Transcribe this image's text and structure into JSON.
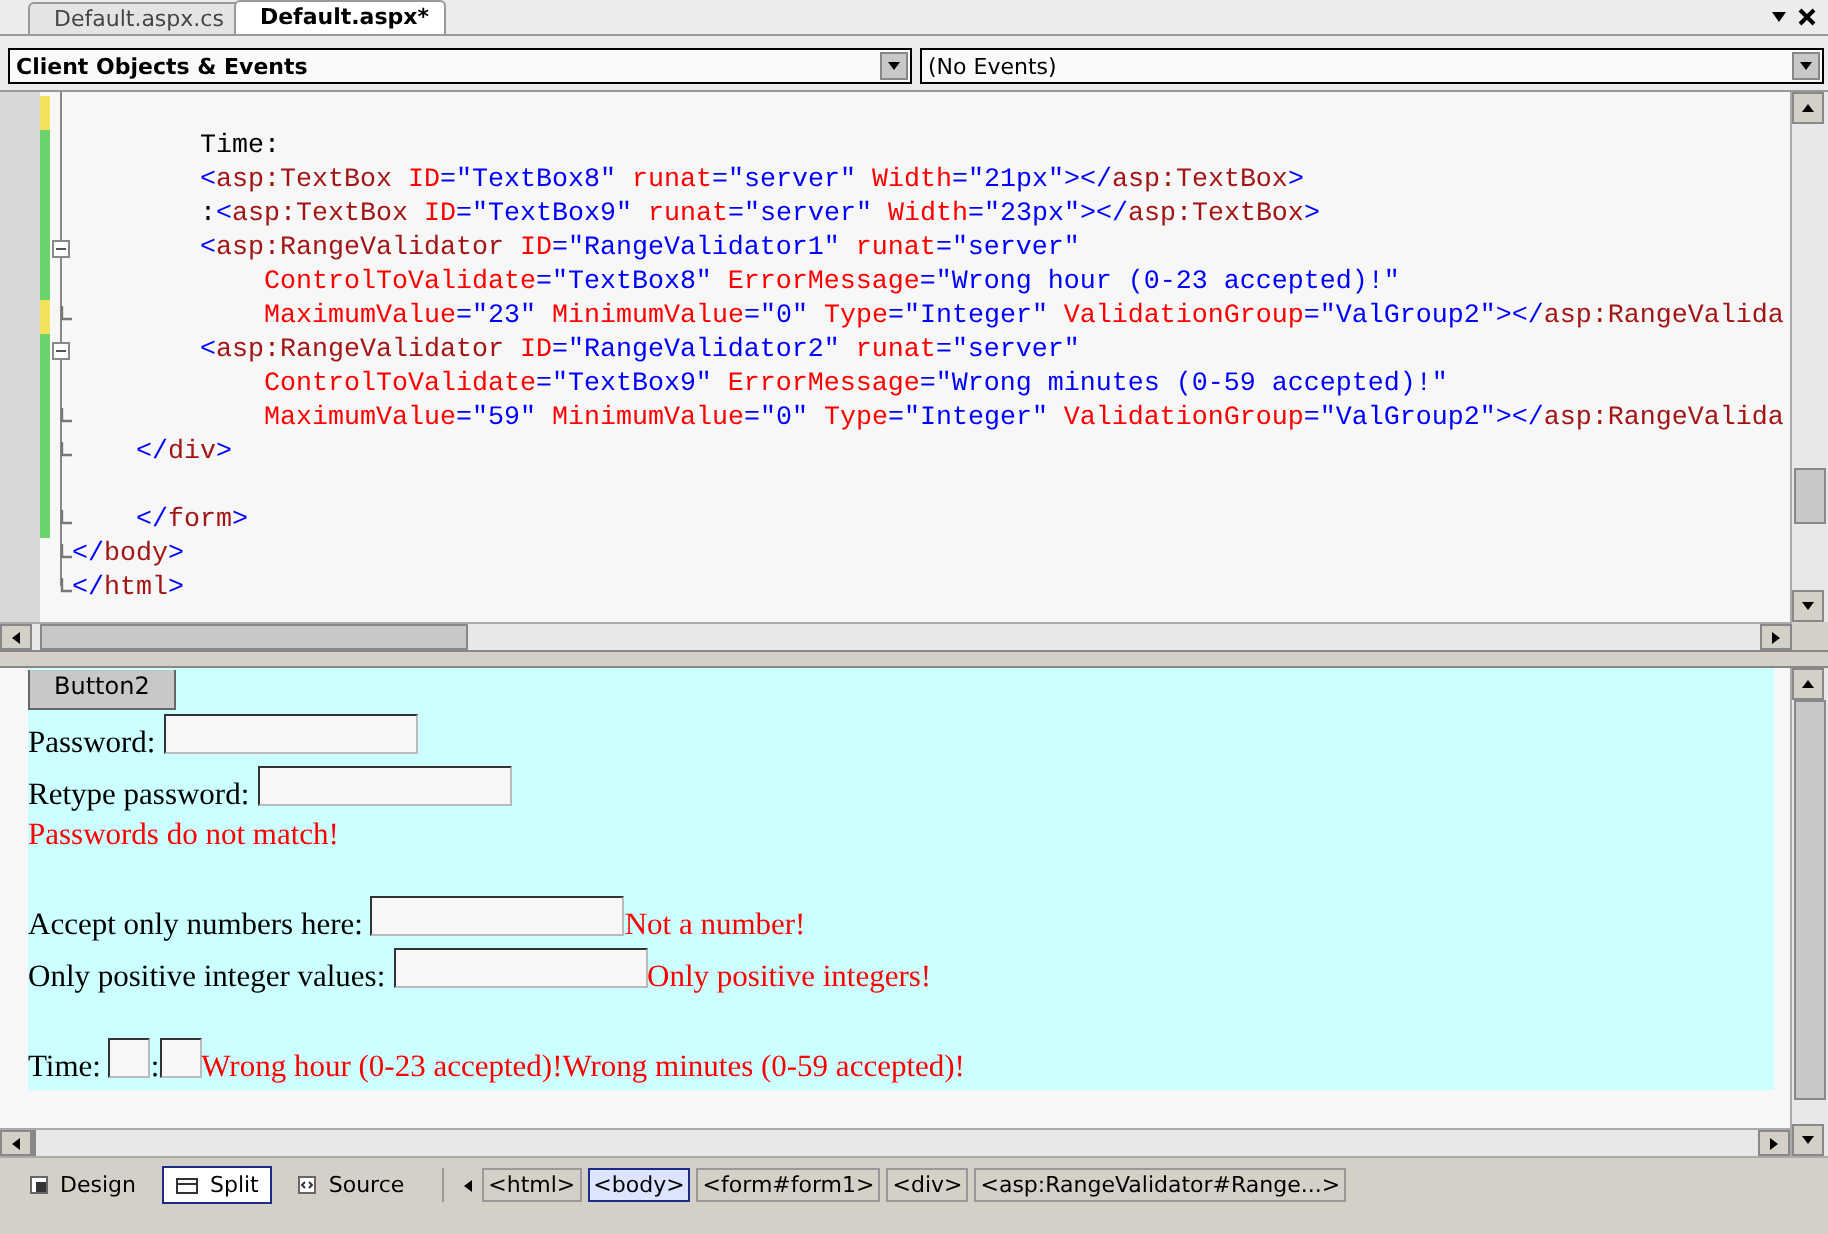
{
  "tabs": [
    {
      "label": "Default.aspx.cs",
      "selected": false
    },
    {
      "label": "Default.aspx*",
      "selected": true
    }
  ],
  "dropdowns": [
    {
      "value": "Client Objects & Events"
    },
    {
      "value": "(No Events)"
    }
  ],
  "code_lines": [
    {
      "modified": true,
      "saved": false,
      "foldable": false,
      "block_end": false
    },
    {
      "modified": true,
      "saved": true,
      "foldable": false,
      "block_end": false,
      "tokens": [
        {
          "kind": "text",
          "text": "        Time:"
        }
      ]
    },
    {
      "modified": true,
      "saved": true,
      "foldable": false,
      "block_end": false,
      "tokens": [
        {
          "kind": "punct",
          "text": "        <"
        },
        {
          "kind": "tag",
          "text": "asp:TextBox"
        },
        {
          "kind": "attr",
          "text": " ID"
        },
        {
          "kind": "punct",
          "text": "="
        },
        {
          "kind": "value",
          "text": "\"TextBox8\""
        },
        {
          "kind": "attr",
          "text": " runat"
        },
        {
          "kind": "punct",
          "text": "="
        },
        {
          "kind": "value",
          "text": "\"server\""
        },
        {
          "kind": "attr",
          "text": " Width"
        },
        {
          "kind": "punct",
          "text": "="
        },
        {
          "kind": "value",
          "text": "\"21px\""
        },
        {
          "kind": "punct",
          "text": "></"
        },
        {
          "kind": "tag",
          "text": "asp:TextBox"
        },
        {
          "kind": "punct",
          "text": ">"
        }
      ]
    },
    {
      "modified": true,
      "saved": true,
      "foldable": false,
      "block_end": false,
      "tokens": [
        {
          "kind": "text",
          "text": "        :"
        },
        {
          "kind": "punct",
          "text": "<"
        },
        {
          "kind": "tag",
          "text": "asp:TextBox"
        },
        {
          "kind": "attr",
          "text": " ID"
        },
        {
          "kind": "punct",
          "text": "="
        },
        {
          "kind": "value",
          "text": "\"TextBox9\""
        },
        {
          "kind": "attr",
          "text": " runat"
        },
        {
          "kind": "punct",
          "text": "="
        },
        {
          "kind": "value",
          "text": "\"server\""
        },
        {
          "kind": "attr",
          "text": " Width"
        },
        {
          "kind": "punct",
          "text": "="
        },
        {
          "kind": "value",
          "text": "\"23px\""
        },
        {
          "kind": "punct",
          "text": "></"
        },
        {
          "kind": "tag",
          "text": "asp:TextBox"
        },
        {
          "kind": "punct",
          "text": ">"
        }
      ]
    },
    {
      "modified": true,
      "saved": true,
      "foldable": true,
      "block_end": false,
      "tokens": [
        {
          "kind": "punct",
          "text": "        <"
        },
        {
          "kind": "tag",
          "text": "asp:RangeValidator"
        },
        {
          "kind": "attr",
          "text": " ID"
        },
        {
          "kind": "punct",
          "text": "="
        },
        {
          "kind": "value",
          "text": "\"RangeValidator1\""
        },
        {
          "kind": "attr",
          "text": " runat"
        },
        {
          "kind": "punct",
          "text": "="
        },
        {
          "kind": "value",
          "text": "\"server\""
        }
      ]
    },
    {
      "modified": true,
      "saved": true,
      "foldable": false,
      "block_end": false,
      "tokens": [
        {
          "kind": "attr",
          "text": "            ControlToValidate"
        },
        {
          "kind": "punct",
          "text": "="
        },
        {
          "kind": "value",
          "text": "\"TextBox8\""
        },
        {
          "kind": "attr",
          "text": " ErrorMessage"
        },
        {
          "kind": "punct",
          "text": "="
        },
        {
          "kind": "value",
          "text": "\"Wrong hour (0-23 accepted)!\""
        }
      ]
    },
    {
      "modified": true,
      "saved": false,
      "foldable": false,
      "block_end": true,
      "tokens": [
        {
          "kind": "attr",
          "text": "            MaximumValue"
        },
        {
          "kind": "punct",
          "text": "="
        },
        {
          "kind": "value",
          "text": "\"23\""
        },
        {
          "kind": "attr",
          "text": " MinimumValue"
        },
        {
          "kind": "punct",
          "text": "="
        },
        {
          "kind": "value",
          "text": "\"0\""
        },
        {
          "kind": "attr",
          "text": " Type"
        },
        {
          "kind": "punct",
          "text": "="
        },
        {
          "kind": "value",
          "text": "\"Integer\""
        },
        {
          "kind": "attr",
          "text": " ValidationGroup"
        },
        {
          "kind": "punct",
          "text": "="
        },
        {
          "kind": "value",
          "text": "\"ValGroup2\""
        },
        {
          "kind": "punct",
          "text": "></"
        },
        {
          "kind": "tag",
          "text": "asp:RangeValida"
        }
      ]
    },
    {
      "modified": true,
      "saved": true,
      "foldable": true,
      "block_end": false,
      "tokens": [
        {
          "kind": "punct",
          "text": "        <"
        },
        {
          "kind": "tag",
          "text": "asp:RangeValidator"
        },
        {
          "kind": "attr",
          "text": " ID"
        },
        {
          "kind": "punct",
          "text": "="
        },
        {
          "kind": "value",
          "text": "\"RangeValidator2\""
        },
        {
          "kind": "attr",
          "text": " runat"
        },
        {
          "kind": "punct",
          "text": "="
        },
        {
          "kind": "value",
          "text": "\"server\""
        }
      ]
    },
    {
      "modified": true,
      "saved": true,
      "foldable": false,
      "block_end": false,
      "tokens": [
        {
          "kind": "attr",
          "text": "            ControlToValidate"
        },
        {
          "kind": "punct",
          "text": "="
        },
        {
          "kind": "value",
          "text": "\"TextBox9\""
        },
        {
          "kind": "attr",
          "text": " ErrorMessage"
        },
        {
          "kind": "punct",
          "text": "="
        },
        {
          "kind": "value",
          "text": "\"Wrong minutes (0-59 accepted)!\""
        }
      ]
    },
    {
      "modified": true,
      "saved": true,
      "foldable": false,
      "block_end": true,
      "tokens": [
        {
          "kind": "attr",
          "text": "            MaximumValue"
        },
        {
          "kind": "punct",
          "text": "="
        },
        {
          "kind": "value",
          "text": "\"59\""
        },
        {
          "kind": "attr",
          "text": " MinimumValue"
        },
        {
          "kind": "punct",
          "text": "="
        },
        {
          "kind": "value",
          "text": "\"0\""
        },
        {
          "kind": "attr",
          "text": " Type"
        },
        {
          "kind": "punct",
          "text": "="
        },
        {
          "kind": "value",
          "text": "\"Integer\""
        },
        {
          "kind": "attr",
          "text": " ValidationGroup"
        },
        {
          "kind": "punct",
          "text": "="
        },
        {
          "kind": "value",
          "text": "\"ValGroup2\""
        },
        {
          "kind": "punct",
          "text": "></"
        },
        {
          "kind": "tag",
          "text": "asp:RangeValida"
        }
      ]
    },
    {
      "modified": true,
      "saved": true,
      "foldable": false,
      "block_end": true,
      "tokens": [
        {
          "kind": "punct",
          "text": "    </"
        },
        {
          "kind": "tag",
          "text": "div"
        },
        {
          "kind": "punct",
          "text": ">"
        }
      ]
    },
    {
      "modified": true,
      "saved": true,
      "foldable": false,
      "block_end": false
    },
    {
      "modified": true,
      "saved": true,
      "foldable": false,
      "block_end": true,
      "tokens": [
        {
          "kind": "punct",
          "text": "    </"
        },
        {
          "kind": "tag",
          "text": "form"
        },
        {
          "kind": "punct",
          "text": ">"
        }
      ]
    },
    {
      "modified": false,
      "foldable": false,
      "block_end": true,
      "tokens": [
        {
          "kind": "punct",
          "text": "</"
        },
        {
          "kind": "tag",
          "text": "body"
        },
        {
          "kind": "punct",
          "text": ">"
        }
      ]
    },
    {
      "modified": false,
      "foldable": false,
      "block_end": true,
      "tokens": [
        {
          "kind": "punct",
          "text": "</"
        },
        {
          "kind": "tag",
          "text": "html"
        },
        {
          "kind": "punct",
          "text": ">"
        }
      ]
    }
  ],
  "design": {
    "button": "Button2",
    "groups": [
      [
        {
          "items": [
            {
              "kind": "label",
              "text": "Password: "
            },
            {
              "kind": "input"
            }
          ]
        },
        {
          "items": [
            {
              "kind": "label",
              "text": "Retype password: "
            },
            {
              "kind": "input"
            }
          ]
        },
        {
          "items": [
            {
              "kind": "error",
              "text": "Passwords do not match!"
            }
          ]
        }
      ],
      [
        {
          "items": [
            {
              "kind": "label",
              "text": "Accept only numbers here: "
            },
            {
              "kind": "input"
            },
            {
              "kind": "error",
              "text": "Not a number!"
            }
          ]
        },
        {
          "items": [
            {
              "kind": "label",
              "text": "Only positive integer values: "
            },
            {
              "kind": "input"
            },
            {
              "kind": "error",
              "text": "Only positive integers!"
            }
          ]
        }
      ],
      [
        {
          "items": [
            {
              "kind": "label",
              "text": "Time: "
            },
            {
              "kind": "small_input"
            },
            {
              "kind": "label",
              "text": ":"
            },
            {
              "kind": "small_input"
            },
            {
              "kind": "error",
              "text": "Wrong hour (0-23 accepted)!"
            },
            {
              "kind": "error",
              "text": "Wrong minutes (0-59 accepted)!"
            }
          ]
        }
      ]
    ]
  },
  "views": [
    {
      "label": "Design",
      "selected": false
    },
    {
      "label": "Split",
      "selected": true
    },
    {
      "label": "Source",
      "selected": false
    }
  ],
  "breadcrumb": [
    {
      "label": "<html>",
      "selected": false
    },
    {
      "label": "<body>",
      "selected": true
    },
    {
      "label": "<form#form1>",
      "selected": false
    },
    {
      "label": "<div>",
      "selected": false
    },
    {
      "label": "<asp:RangeValidator#Range...>",
      "selected": false
    }
  ]
}
